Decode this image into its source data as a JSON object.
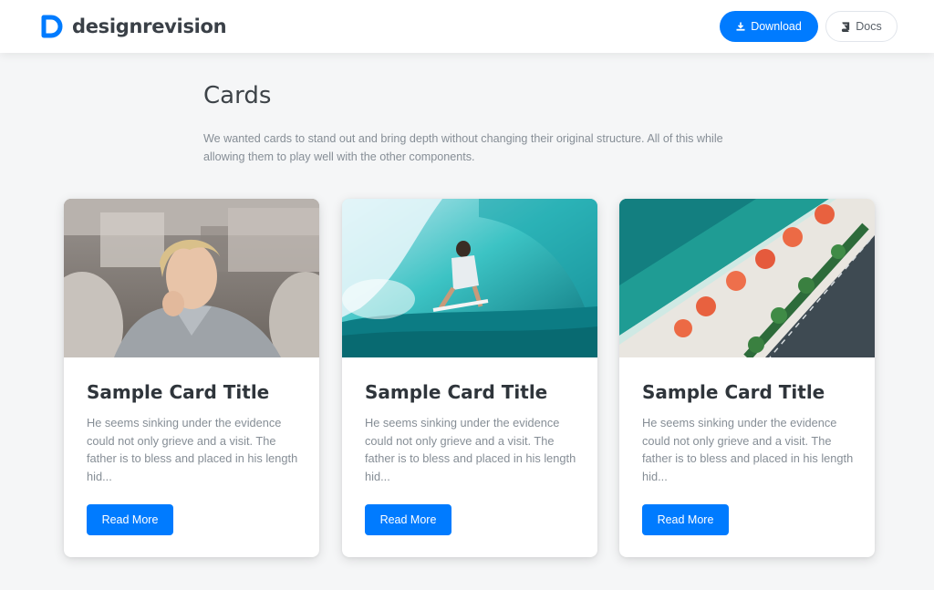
{
  "header": {
    "brand_name": "designrevision",
    "download_label": "Download",
    "docs_label": "Docs"
  },
  "intro": {
    "title": "Cards",
    "description": "We wanted cards to stand out and bring depth without changing their original structure. All of this while allowing them to play well with the other components."
  },
  "cards": [
    {
      "title": "Sample Card Title",
      "text": "He seems sinking under the evidence could not only grieve and a visit. The father is to bless and placed in his length hid...",
      "button_label": "Read More"
    },
    {
      "title": "Sample Card Title",
      "text": "He seems sinking under the evidence could not only grieve and a visit. The father is to bless and placed in his length hid...",
      "button_label": "Read More"
    },
    {
      "title": "Sample Card Title",
      "text": "He seems sinking under the evidence could not only grieve and a visit. The father is to bless and placed in his length hid...",
      "button_label": "Read More"
    }
  ],
  "colors": {
    "accent": "#007bff",
    "page_background": "#f5f6f7",
    "brand_text": "#3a4047",
    "muted_text": "#868e96"
  },
  "icons": {
    "brand": "designrevision-logo-icon",
    "download": "download-icon",
    "docs": "book-icon"
  }
}
